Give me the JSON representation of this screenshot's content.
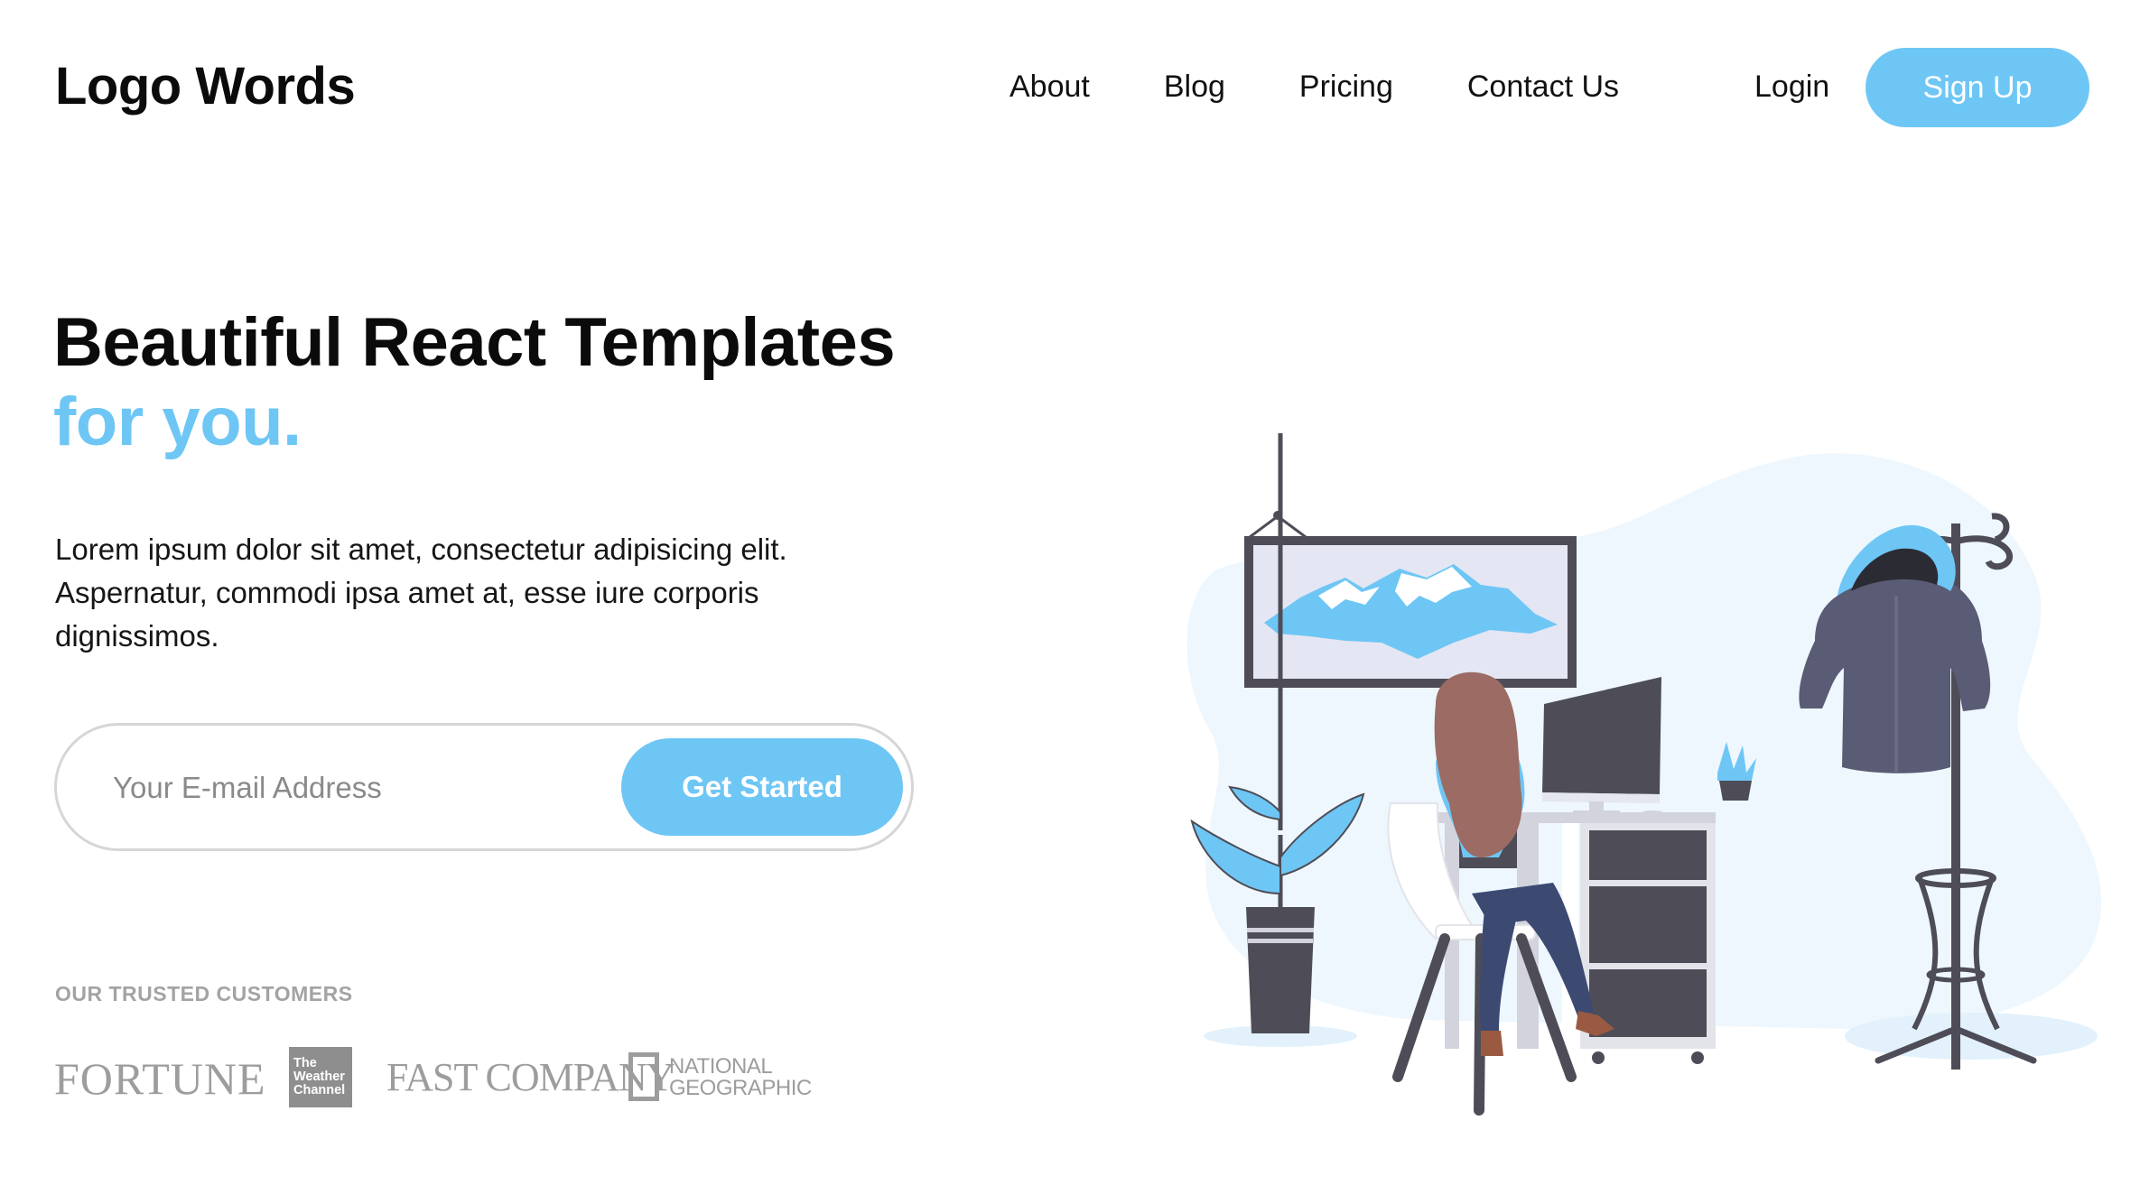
{
  "header": {
    "logo": "Logo Words",
    "nav": [
      "About",
      "Blog",
      "Pricing",
      "Contact Us"
    ],
    "login": "Login",
    "signup": "Sign Up"
  },
  "hero": {
    "title": "Beautiful React Templates",
    "title_accent": "for you.",
    "description": "Lorem ipsum dolor sit amet, consectetur adipisicing elit. Aspernatur, commodi ipsa amet at, esse iure corporis dignissimos.",
    "email_placeholder": "Your E-mail Address",
    "cta": "Get Started"
  },
  "trusted": {
    "label": "OUR TRUSTED CUSTOMERS",
    "logos": {
      "fortune": "FORTUNE",
      "weather_channel": [
        "The",
        "Weather",
        "Channel"
      ],
      "fast_company": "FAST COMPANY",
      "national_geographic": [
        "NATIONAL",
        "GEOGRAPHIC"
      ]
    }
  },
  "illustration": {
    "subject": "woman at desk with monitor, framed mountain painting, potted plants, coat rack with jacket"
  },
  "colors": {
    "accent": "#6ec6f5",
    "text": "#111111",
    "muted": "#a3a3a3",
    "border": "#d6d6d6",
    "furniture": "#4e4d57",
    "blob": "#eef7fd"
  }
}
